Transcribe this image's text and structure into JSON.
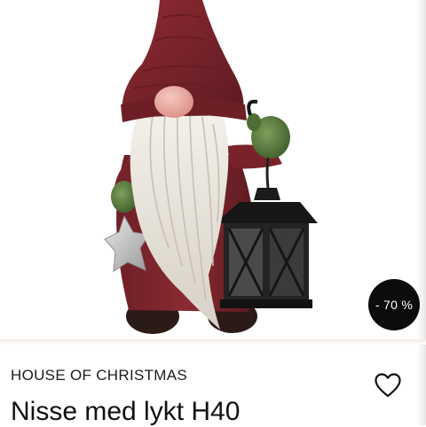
{
  "product": {
    "image_alt": "Nisse med lykt",
    "discount_badge": "- 70 %",
    "brand": "HOUSE OF CHRISTMAS",
    "title": "Nisse med lykt H40",
    "favorite_icon": "heart-outline-icon"
  }
}
